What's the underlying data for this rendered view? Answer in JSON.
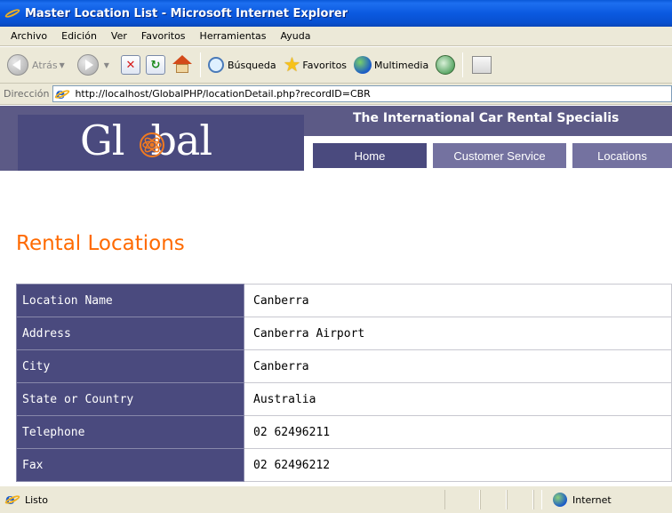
{
  "window": {
    "title": "Master Location List - Microsoft Internet Explorer"
  },
  "menu": [
    "Archivo",
    "Edición",
    "Ver",
    "Favoritos",
    "Herramientas",
    "Ayuda"
  ],
  "toolbar": {
    "back_label": "Atrás",
    "search_label": "Búsqueda",
    "favorites_label": "Favoritos",
    "media_label": "Multimedia"
  },
  "address": {
    "label": "Dirección",
    "url": "http://localhost/GlobalPHP/locationDetail.php?recordID=CBR"
  },
  "site": {
    "logo_text_left": "Gl",
    "logo_text_right": "bal",
    "tagline": "The International Car Rental Specialis",
    "nav": [
      "Home",
      "Customer Service",
      "Locations"
    ]
  },
  "page": {
    "heading": "Rental Locations"
  },
  "details": [
    {
      "label": "Location Name",
      "value": "Canberra"
    },
    {
      "label": "Address",
      "value": "Canberra Airport"
    },
    {
      "label": "City",
      "value": "Canberra"
    },
    {
      "label": "State or Country",
      "value": "Australia"
    },
    {
      "label": "Telephone",
      "value": "02 62496211"
    },
    {
      "label": "Fax",
      "value": "02 62496212"
    }
  ],
  "status": {
    "text": "Listo",
    "zone": "Internet"
  },
  "colors": {
    "header_bg": "#5c5a86",
    "label_bg": "#4a4a7e",
    "heading_orange": "#ff6a00"
  }
}
